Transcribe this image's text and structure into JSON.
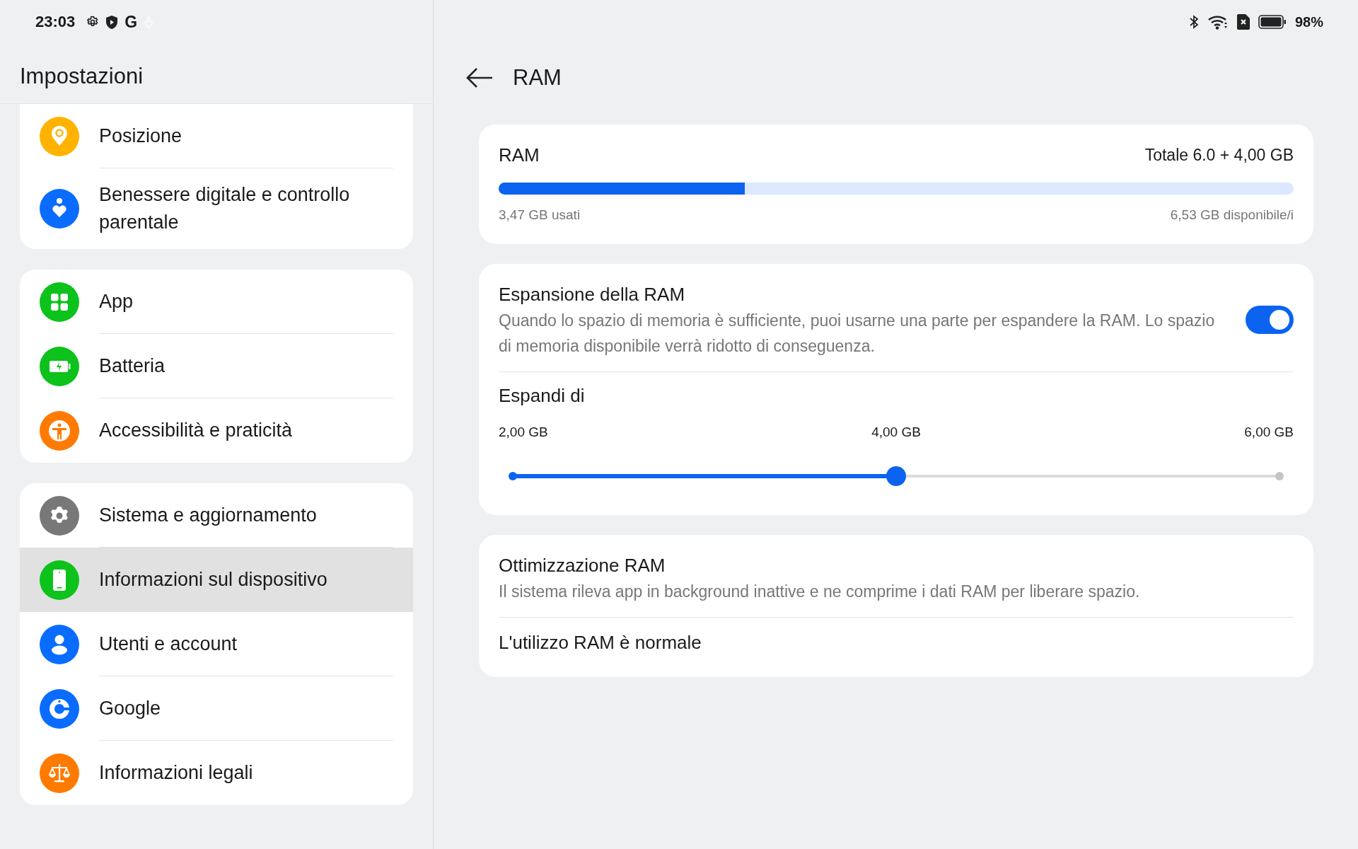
{
  "status_bar": {
    "time": "23:03",
    "notification_glyph": "G",
    "battery": "98%"
  },
  "sidebar": {
    "title": "Impostazioni",
    "groups": [
      {
        "items": [
          {
            "label": "Posizione",
            "kind": "location",
            "selected": false
          },
          {
            "label": "Benessere digitale e controllo parentale",
            "kind": "wellbeing",
            "selected": false
          }
        ]
      },
      {
        "items": [
          {
            "label": "App",
            "kind": "apps",
            "selected": false
          },
          {
            "label": "Batteria",
            "kind": "battery",
            "selected": false
          },
          {
            "label": "Accessibilità e praticità",
            "kind": "accessibility",
            "selected": false
          }
        ]
      },
      {
        "items": [
          {
            "label": "Sistema e aggiornamento",
            "kind": "system",
            "selected": false
          },
          {
            "label": "Informazioni sul dispositivo",
            "kind": "device",
            "selected": true
          },
          {
            "label": "Utenti e account",
            "kind": "user",
            "selected": false
          },
          {
            "label": "Google",
            "kind": "google",
            "selected": false
          },
          {
            "label": "Informazioni legali",
            "kind": "legal",
            "selected": false
          }
        ]
      }
    ]
  },
  "page": {
    "title": "RAM",
    "usage": {
      "title": "RAM",
      "total": "Totale 6.0 + 4,00 GB",
      "level": 0.31,
      "used": "3,47 GB usati",
      "available": "6,53 GB disponibile/i"
    },
    "expansion": {
      "title": "Espansione della RAM",
      "description": "Quando lo spazio di memoria è sufficiente, puoi usarne una parte per espandere la RAM. Lo spazio di memoria disponibile verrà ridotto di conseguenza.",
      "on": true,
      "expand_label": "Espandi di",
      "ticks": [
        "2,00 GB",
        "4,00 GB",
        "6,00 GB"
      ],
      "level": 0.5
    },
    "optimization": {
      "title": "Ottimizzazione RAM",
      "description": "Il sistema rileva app in background inattive e ne comprime i dati RAM per liberare spazio.",
      "status": "L'utilizzo RAM è normale"
    }
  }
}
